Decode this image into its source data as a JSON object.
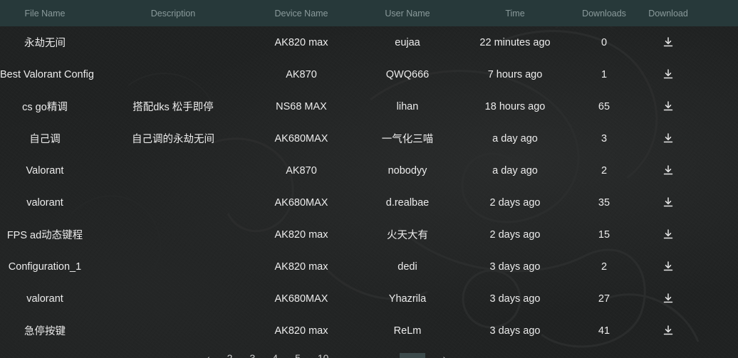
{
  "columns": {
    "file_name": "File Name",
    "description": "Description",
    "device_name": "Device Name",
    "user_name": "User Name",
    "time": "Time",
    "downloads": "Downloads",
    "download": "Download"
  },
  "rows": [
    {
      "file": "永劫无间",
      "desc": "",
      "device": "AK820 max",
      "user": "eujaa",
      "time": "22 minutes ago",
      "downloads": "0"
    },
    {
      "file": "Best Valorant Config",
      "desc": "",
      "device": "AK870",
      "user": "QWQ666",
      "time": "7 hours ago",
      "downloads": "1"
    },
    {
      "file": "cs go精调",
      "desc": "搭配dks 松手即停",
      "device": "NS68 MAX",
      "user": "lihan",
      "time": "18 hours ago",
      "downloads": "65"
    },
    {
      "file": "自己调",
      "desc": "自己调的永劫无间",
      "device": "AK680MAX",
      "user": "一气化三喵",
      "time": "a day ago",
      "downloads": "3"
    },
    {
      "file": "Valorant",
      "desc": "",
      "device": "AK870",
      "user": "nobodyy",
      "time": "a day ago",
      "downloads": "2"
    },
    {
      "file": "valorant",
      "desc": "",
      "device": "AK680MAX",
      "user": "d.realbae",
      "time": "2 days ago",
      "downloads": "35"
    },
    {
      "file": "FPS ad动态键程",
      "desc": "",
      "device": "AK820 max",
      "user": "火天大有",
      "time": "2 days ago",
      "downloads": "15"
    },
    {
      "file": "Configuration_1",
      "desc": "",
      "device": "AK820 max",
      "user": "dedi",
      "time": "3 days ago",
      "downloads": "2"
    },
    {
      "file": "valorant",
      "desc": "",
      "device": "AK680MAX",
      "user": "Yhazrila",
      "time": "3 days ago",
      "downloads": "27"
    },
    {
      "file": "急停按键",
      "desc": "",
      "device": "AK820 max",
      "user": "ReLm",
      "time": "3 days ago",
      "downloads": "41"
    }
  ],
  "icons": {
    "download": "download-icon"
  },
  "colors": {
    "header_bg": "#27393a",
    "header_text": "#8a9a9b",
    "row_text": "#ececec",
    "page_bg": "#202222"
  }
}
